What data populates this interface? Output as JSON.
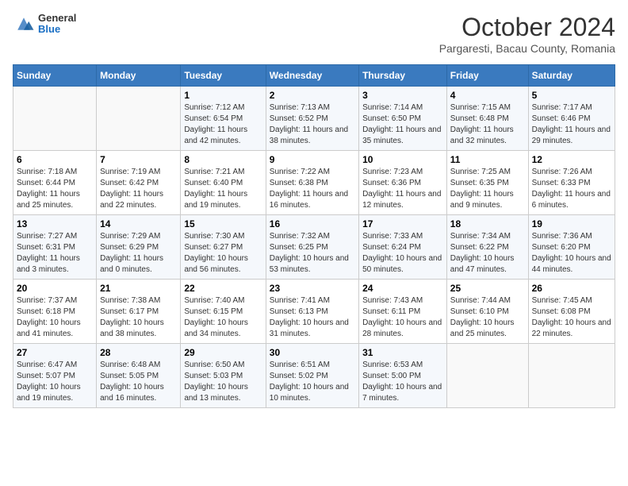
{
  "header": {
    "logo": {
      "general": "General",
      "blue": "Blue"
    },
    "title": "October 2024",
    "subtitle": "Pargaresti, Bacau County, Romania"
  },
  "weekdays": [
    "Sunday",
    "Monday",
    "Tuesday",
    "Wednesday",
    "Thursday",
    "Friday",
    "Saturday"
  ],
  "weeks": [
    [
      null,
      null,
      {
        "day": 1,
        "sunrise": "Sunrise: 7:12 AM",
        "sunset": "Sunset: 6:54 PM",
        "daylight": "Daylight: 11 hours and 42 minutes."
      },
      {
        "day": 2,
        "sunrise": "Sunrise: 7:13 AM",
        "sunset": "Sunset: 6:52 PM",
        "daylight": "Daylight: 11 hours and 38 minutes."
      },
      {
        "day": 3,
        "sunrise": "Sunrise: 7:14 AM",
        "sunset": "Sunset: 6:50 PM",
        "daylight": "Daylight: 11 hours and 35 minutes."
      },
      {
        "day": 4,
        "sunrise": "Sunrise: 7:15 AM",
        "sunset": "Sunset: 6:48 PM",
        "daylight": "Daylight: 11 hours and 32 minutes."
      },
      {
        "day": 5,
        "sunrise": "Sunrise: 7:17 AM",
        "sunset": "Sunset: 6:46 PM",
        "daylight": "Daylight: 11 hours and 29 minutes."
      }
    ],
    [
      {
        "day": 6,
        "sunrise": "Sunrise: 7:18 AM",
        "sunset": "Sunset: 6:44 PM",
        "daylight": "Daylight: 11 hours and 25 minutes."
      },
      {
        "day": 7,
        "sunrise": "Sunrise: 7:19 AM",
        "sunset": "Sunset: 6:42 PM",
        "daylight": "Daylight: 11 hours and 22 minutes."
      },
      {
        "day": 8,
        "sunrise": "Sunrise: 7:21 AM",
        "sunset": "Sunset: 6:40 PM",
        "daylight": "Daylight: 11 hours and 19 minutes."
      },
      {
        "day": 9,
        "sunrise": "Sunrise: 7:22 AM",
        "sunset": "Sunset: 6:38 PM",
        "daylight": "Daylight: 11 hours and 16 minutes."
      },
      {
        "day": 10,
        "sunrise": "Sunrise: 7:23 AM",
        "sunset": "Sunset: 6:36 PM",
        "daylight": "Daylight: 11 hours and 12 minutes."
      },
      {
        "day": 11,
        "sunrise": "Sunrise: 7:25 AM",
        "sunset": "Sunset: 6:35 PM",
        "daylight": "Daylight: 11 hours and 9 minutes."
      },
      {
        "day": 12,
        "sunrise": "Sunrise: 7:26 AM",
        "sunset": "Sunset: 6:33 PM",
        "daylight": "Daylight: 11 hours and 6 minutes."
      }
    ],
    [
      {
        "day": 13,
        "sunrise": "Sunrise: 7:27 AM",
        "sunset": "Sunset: 6:31 PM",
        "daylight": "Daylight: 11 hours and 3 minutes."
      },
      {
        "day": 14,
        "sunrise": "Sunrise: 7:29 AM",
        "sunset": "Sunset: 6:29 PM",
        "daylight": "Daylight: 11 hours and 0 minutes."
      },
      {
        "day": 15,
        "sunrise": "Sunrise: 7:30 AM",
        "sunset": "Sunset: 6:27 PM",
        "daylight": "Daylight: 10 hours and 56 minutes."
      },
      {
        "day": 16,
        "sunrise": "Sunrise: 7:32 AM",
        "sunset": "Sunset: 6:25 PM",
        "daylight": "Daylight: 10 hours and 53 minutes."
      },
      {
        "day": 17,
        "sunrise": "Sunrise: 7:33 AM",
        "sunset": "Sunset: 6:24 PM",
        "daylight": "Daylight: 10 hours and 50 minutes."
      },
      {
        "day": 18,
        "sunrise": "Sunrise: 7:34 AM",
        "sunset": "Sunset: 6:22 PM",
        "daylight": "Daylight: 10 hours and 47 minutes."
      },
      {
        "day": 19,
        "sunrise": "Sunrise: 7:36 AM",
        "sunset": "Sunset: 6:20 PM",
        "daylight": "Daylight: 10 hours and 44 minutes."
      }
    ],
    [
      {
        "day": 20,
        "sunrise": "Sunrise: 7:37 AM",
        "sunset": "Sunset: 6:18 PM",
        "daylight": "Daylight: 10 hours and 41 minutes."
      },
      {
        "day": 21,
        "sunrise": "Sunrise: 7:38 AM",
        "sunset": "Sunset: 6:17 PM",
        "daylight": "Daylight: 10 hours and 38 minutes."
      },
      {
        "day": 22,
        "sunrise": "Sunrise: 7:40 AM",
        "sunset": "Sunset: 6:15 PM",
        "daylight": "Daylight: 10 hours and 34 minutes."
      },
      {
        "day": 23,
        "sunrise": "Sunrise: 7:41 AM",
        "sunset": "Sunset: 6:13 PM",
        "daylight": "Daylight: 10 hours and 31 minutes."
      },
      {
        "day": 24,
        "sunrise": "Sunrise: 7:43 AM",
        "sunset": "Sunset: 6:11 PM",
        "daylight": "Daylight: 10 hours and 28 minutes."
      },
      {
        "day": 25,
        "sunrise": "Sunrise: 7:44 AM",
        "sunset": "Sunset: 6:10 PM",
        "daylight": "Daylight: 10 hours and 25 minutes."
      },
      {
        "day": 26,
        "sunrise": "Sunrise: 7:45 AM",
        "sunset": "Sunset: 6:08 PM",
        "daylight": "Daylight: 10 hours and 22 minutes."
      }
    ],
    [
      {
        "day": 27,
        "sunrise": "Sunrise: 6:47 AM",
        "sunset": "Sunset: 5:07 PM",
        "daylight": "Daylight: 10 hours and 19 minutes."
      },
      {
        "day": 28,
        "sunrise": "Sunrise: 6:48 AM",
        "sunset": "Sunset: 5:05 PM",
        "daylight": "Daylight: 10 hours and 16 minutes."
      },
      {
        "day": 29,
        "sunrise": "Sunrise: 6:50 AM",
        "sunset": "Sunset: 5:03 PM",
        "daylight": "Daylight: 10 hours and 13 minutes."
      },
      {
        "day": 30,
        "sunrise": "Sunrise: 6:51 AM",
        "sunset": "Sunset: 5:02 PM",
        "daylight": "Daylight: 10 hours and 10 minutes."
      },
      {
        "day": 31,
        "sunrise": "Sunrise: 6:53 AM",
        "sunset": "Sunset: 5:00 PM",
        "daylight": "Daylight: 10 hours and 7 minutes."
      },
      null,
      null
    ]
  ]
}
